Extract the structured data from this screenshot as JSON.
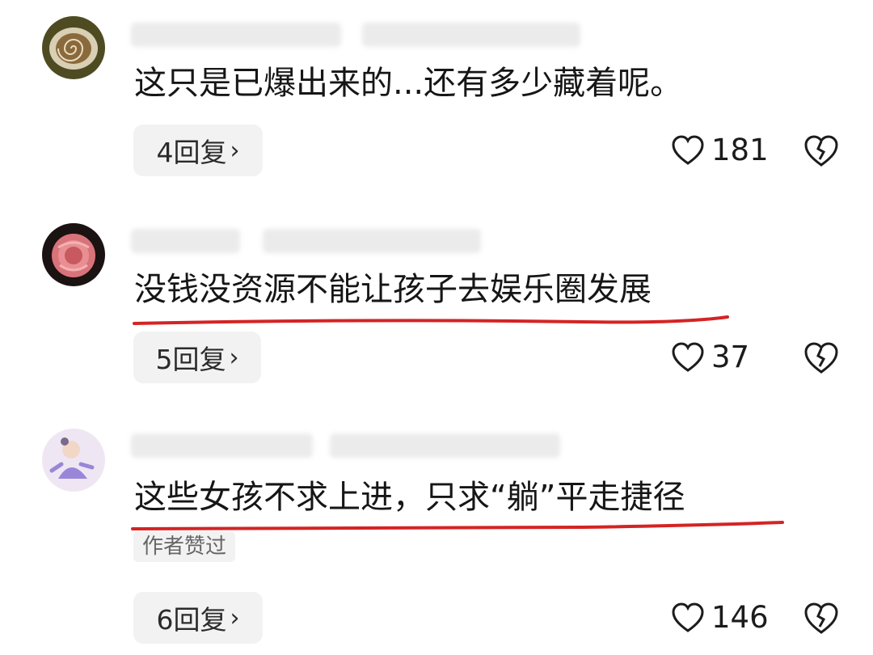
{
  "comments": [
    {
      "text": "这只是已爆出来的...还有多少藏着呢。",
      "replies": "4回复",
      "likes": "181",
      "underlined": false,
      "author_liked": false
    },
    {
      "text": "没钱没资源不能让孩子去娱乐圈发展",
      "replies": "5回复",
      "likes": "37",
      "underlined": true,
      "author_liked": false
    },
    {
      "text": "这些女孩不求上进，只求“躺”平走捷径",
      "replies": "6回复",
      "likes": "146",
      "underlined": true,
      "author_liked": true,
      "author_liked_label": "作者赞过"
    }
  ],
  "icons": {
    "like": "heart-icon",
    "dislike": "broken-heart-icon",
    "reply_more": "chevron-right-icon"
  },
  "colors": {
    "underline": "#d42424",
    "reply_bg": "#f2f2f2"
  }
}
